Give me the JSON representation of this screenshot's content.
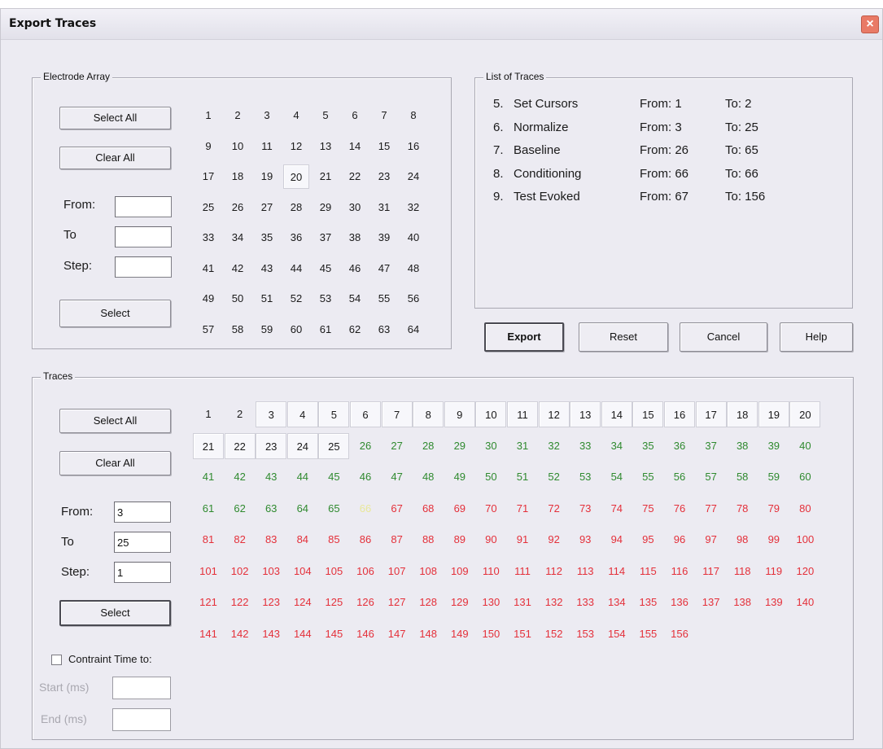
{
  "window": {
    "title": "Export Traces",
    "close_icon": "×"
  },
  "electrode": {
    "group_label": "Electrode Array",
    "select_all": "Select All",
    "clear_all": "Clear All",
    "from_label": "From:",
    "to_label": "To",
    "step_label": "Step:",
    "from_value": "",
    "to_value": "",
    "step_value": "",
    "select": "Select",
    "numbers": [
      1,
      2,
      3,
      4,
      5,
      6,
      7,
      8,
      9,
      10,
      11,
      12,
      13,
      14,
      15,
      16,
      17,
      18,
      19,
      20,
      21,
      22,
      23,
      24,
      25,
      26,
      27,
      28,
      29,
      30,
      31,
      32,
      33,
      34,
      35,
      36,
      37,
      38,
      39,
      40,
      41,
      42,
      43,
      44,
      45,
      46,
      47,
      48,
      49,
      50,
      51,
      52,
      53,
      54,
      55,
      56,
      57,
      58,
      59,
      60,
      61,
      62,
      63,
      64
    ],
    "selected": 20
  },
  "list": {
    "group_label": "List of Traces",
    "rows": [
      {
        "index": "5.",
        "name": "Set Cursors",
        "from": "From: 1",
        "to": "To: 2"
      },
      {
        "index": "6.",
        "name": "Normalize",
        "from": "From: 3",
        "to": "To: 25"
      },
      {
        "index": "7.",
        "name": "Baseline",
        "from": "From: 26",
        "to": "To: 65"
      },
      {
        "index": "8.",
        "name": "Conditioning",
        "from": "From: 66",
        "to": "To: 66"
      },
      {
        "index": "9.",
        "name": "Test Evoked",
        "from": "From: 67",
        "to": "To: 156"
      }
    ]
  },
  "actions": {
    "export": "Export",
    "reset": "Reset",
    "cancel": "Cancel",
    "help": "Help"
  },
  "traces": {
    "group_label": "Traces",
    "select_all": "Select All",
    "clear_all": "Clear All",
    "from_label": "From:",
    "to_label": "To",
    "step_label": "Step:",
    "from_value": "3",
    "to_value": "25",
    "step_value": "1",
    "select": "Select",
    "constraint_label": "Contraint Time to:",
    "constraint_checked": false,
    "start_label": "Start (ms)",
    "end_label": "End (ms)",
    "start_value": "",
    "end_value": "",
    "count": 156,
    "selected_from": 3,
    "selected_to": 25,
    "color_groups": [
      {
        "from": 1,
        "to": 25,
        "color": "default"
      },
      {
        "from": 26,
        "to": 65,
        "color": "green"
      },
      {
        "from": 66,
        "to": 66,
        "color": "yellow"
      },
      {
        "from": 67,
        "to": 156,
        "color": "red"
      }
    ]
  },
  "colors": {
    "window_bg": "#ecebf2",
    "default": "#1a1a1a",
    "green": "#2f8a2f",
    "yellow": "#e9e89a",
    "red": "#e4303a",
    "close": "#e97a66"
  }
}
